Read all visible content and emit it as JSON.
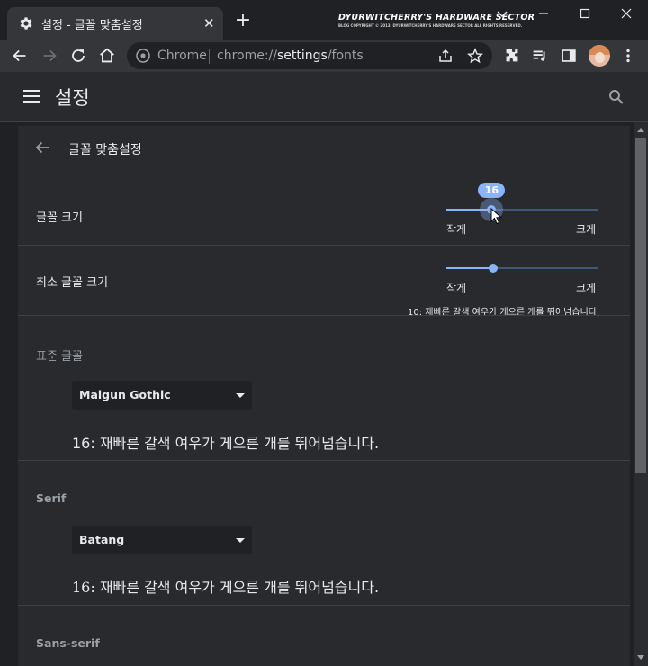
{
  "tab": {
    "title": "설정 - 글꼴 맞춤설정",
    "close": "✕",
    "new_tab": "+"
  },
  "brand": {
    "line1": "DYURWITCHERRY'S HARDWARE SECTOR",
    "line2": "BLOG COPYRIGHT © 2013. DYURWITCHERRY'S HARDWARE SECTOR ALL RIGHTS RESERVED."
  },
  "omnibox": {
    "site": "Chrome",
    "url_prefix": "chrome://",
    "url_host": "settings",
    "url_path": "/fonts"
  },
  "header": {
    "title": "설정"
  },
  "subpage": {
    "title": "글꼴 맞춤설정"
  },
  "font_size": {
    "label": "글꼴 크기",
    "value": "16",
    "level": 0.3,
    "min_label": "작게",
    "max_label": "크게"
  },
  "min_font_size": {
    "label": "최소 글꼴 크기",
    "level": 0.31,
    "min_label": "작게",
    "max_label": "크게",
    "sample": "10: 재빠른 갈색 여우가 게으른 개를 뛰어넘습니다."
  },
  "standard_font": {
    "heading": "표준 글꼴",
    "selected": "Malgun Gothic",
    "sample": "16: 재빠른 갈색 여우가 게으른 개를 뛰어넘습니다."
  },
  "serif_font": {
    "heading": "Serif",
    "selected": "Batang",
    "sample": "16: 재빠른 갈색 여우가 게으른 개를 뛰어넘습니다."
  },
  "sans_serif_font": {
    "heading": "Sans-serif"
  },
  "colors": {
    "accent": "#8ab4f8",
    "background": "#202124",
    "card": "#292a2d"
  }
}
